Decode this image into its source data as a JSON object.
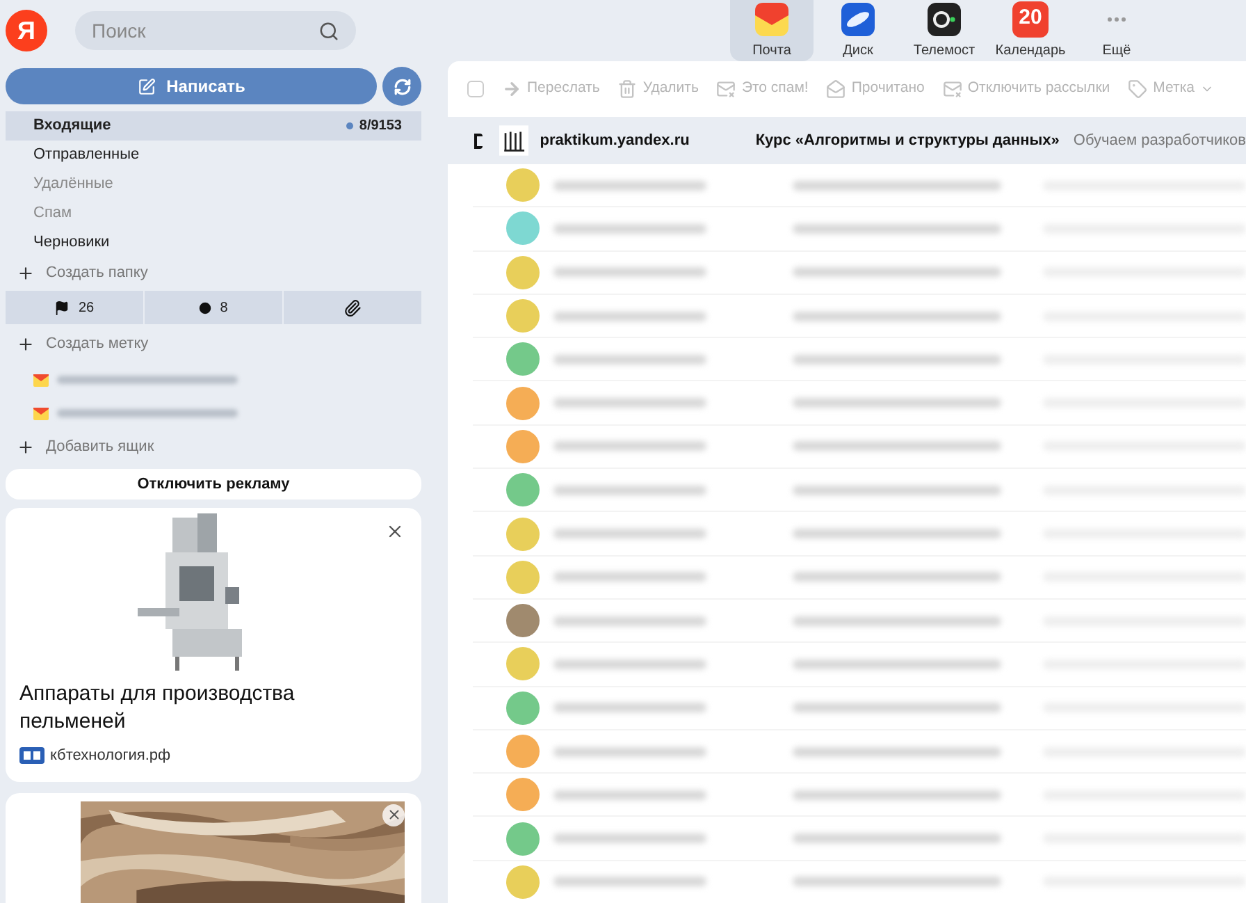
{
  "logo": {
    "letter": "Я"
  },
  "search": {
    "placeholder": "Поиск"
  },
  "apps": [
    {
      "label": "Почта",
      "kind": "mail",
      "selected": true
    },
    {
      "label": "Диск",
      "kind": "disk",
      "selected": false
    },
    {
      "label": "Телемост",
      "kind": "camera",
      "selected": false
    },
    {
      "label": "Календарь",
      "kind": "calendar",
      "badge": "20",
      "selected": false
    },
    {
      "label": "Ещё",
      "kind": "more",
      "selected": false
    }
  ],
  "compose": {
    "label": "Написать"
  },
  "select_all": {
    "checked": false
  },
  "folders": [
    {
      "name": "Входящие",
      "selected": true,
      "count": "8/9153",
      "muted": false
    },
    {
      "name": "Отправленные",
      "selected": false,
      "muted": false
    },
    {
      "name": "Удалённые",
      "selected": false,
      "muted": true
    },
    {
      "name": "Спам",
      "selected": false,
      "muted": true
    },
    {
      "name": "Черновики",
      "selected": false,
      "muted": false
    }
  ],
  "create_folder": "Создать папку",
  "filters": [
    {
      "kind": "flag",
      "count": "26"
    },
    {
      "kind": "unread",
      "count": "8"
    },
    {
      "kind": "attachment"
    }
  ],
  "create_label": "Создать метку",
  "mailboxes": [
    {
      "kind": "redacted"
    },
    {
      "kind": "redacted"
    }
  ],
  "add_mailbox": "Добавить ящик",
  "disable_ads": "Отключить рекламу",
  "ads": [
    {
      "title": "Аппараты для производства пельменей",
      "source": "кбтехнология.рф"
    }
  ],
  "toolbar": [
    {
      "label": "Переслать",
      "kind": "forward",
      "disabled": true
    },
    {
      "label": "Удалить",
      "kind": "delete",
      "disabled": true
    },
    {
      "label": "Это спам!",
      "kind": "spam",
      "disabled": true
    },
    {
      "label": "Прочитано",
      "kind": "read",
      "disabled": true
    },
    {
      "label": "Отключить рассылки",
      "kind": "unsubscribe",
      "disabled": true
    },
    {
      "label": "Метка",
      "kind": "label",
      "disabled": true
    }
  ],
  "first_message": {
    "sender": "praktikum.yandex.ru",
    "subject": "Курс «Алгоритмы и структуры данных»",
    "preview": "Обучаем разработчиков",
    "selected": true
  },
  "redacted_messages": [
    {
      "color": "#e8cf5a"
    },
    {
      "color": "#7ed8d2"
    },
    {
      "color": "#e8cf5a"
    },
    {
      "color": "#e8cf5a"
    },
    {
      "color": "#74c98a"
    },
    {
      "color": "#f5ad55"
    },
    {
      "color": "#f5ad55"
    },
    {
      "color": "#74c98a"
    },
    {
      "color": "#e8cf5a"
    },
    {
      "color": "#e8cf5a"
    },
    {
      "color": "#a08a6e"
    },
    {
      "color": "#e8cf5a"
    },
    {
      "color": "#74c98a"
    },
    {
      "color": "#f5ad55"
    },
    {
      "color": "#f5ad55"
    },
    {
      "color": "#74c98a"
    },
    {
      "color": "#e8cf5a"
    }
  ]
}
